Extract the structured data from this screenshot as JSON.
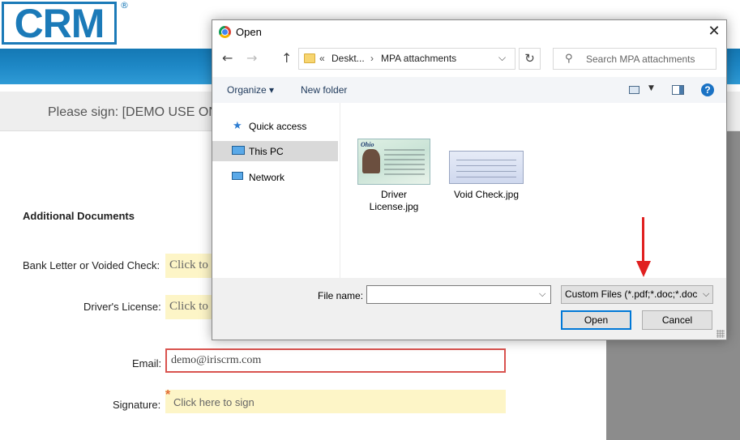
{
  "page": {
    "logo_text": "CRM",
    "logo_reg": "®",
    "header_text": "Please sign: [DEMO USE ON",
    "section_heading": "Additional Documents",
    "fields": [
      {
        "label": "Bank Letter or Voided Check:",
        "value": "Click to"
      },
      {
        "label": "Driver's License:",
        "value": "Click to"
      },
      {
        "label": "Email:",
        "value": "demo@iriscrm.com"
      },
      {
        "label": "Signature:",
        "value": "Click here to sign",
        "required_mark": "*"
      }
    ],
    "colors": {
      "brand": "#1b7ab8",
      "field_yellow": "#fdf5c7",
      "email_border": "#d9534f",
      "arrow": "#e02020"
    }
  },
  "dialog": {
    "title": "Open",
    "app_icon": "chrome-icon",
    "close_glyph": "✕",
    "nav": {
      "back": "←",
      "forward": "→",
      "up": "↑"
    },
    "address": {
      "prefix": "«",
      "segments": [
        "Deskt...",
        "MPA attachments"
      ],
      "separator": "›",
      "dropdown": "⌵",
      "refresh": "↻"
    },
    "search_placeholder": "Search MPA attachments",
    "toolbar": {
      "organize": "Organize ▾",
      "new_folder": "New folder",
      "help": "?"
    },
    "sidebar": [
      {
        "label": "Quick access",
        "icon": "star-icon",
        "selected": false
      },
      {
        "label": "This PC",
        "icon": "computer-icon",
        "selected": true
      },
      {
        "label": "Network",
        "icon": "network-icon",
        "selected": false
      }
    ],
    "files": [
      {
        "name_line1": "Driver",
        "name_line2": "License.jpg",
        "thumb_text": "Ohio"
      },
      {
        "name_line1": "Void Check.jpg",
        "name_line2": ""
      }
    ],
    "file_name_label": "File name:",
    "file_name_value": "",
    "filter_label": "Custom Files (*.pdf;*.doc;*.doc",
    "open_button": "Open",
    "cancel_button": "Cancel"
  }
}
